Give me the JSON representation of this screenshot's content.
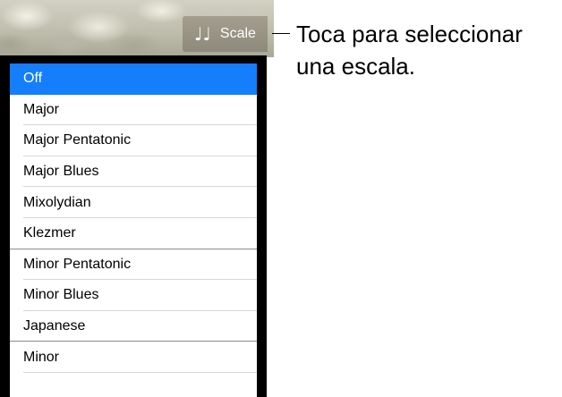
{
  "toolbar": {
    "scale_button": {
      "icon": "music-notes-icon",
      "glyph": "♩♩",
      "label": "Scale"
    }
  },
  "callout": {
    "text": "Toca para seleccionar una escala."
  },
  "scale_menu": {
    "selected": "Off",
    "items": [
      {
        "label": "Off"
      },
      {
        "label": "Major"
      },
      {
        "label": "Major Pentatonic"
      },
      {
        "label": "Major Blues"
      },
      {
        "label": "Mixolydian"
      },
      {
        "label": "Klezmer"
      },
      {
        "label": "Minor Pentatonic"
      },
      {
        "label": "Minor Blues"
      },
      {
        "label": "Japanese"
      },
      {
        "label": "Minor"
      }
    ]
  },
  "colors": {
    "selection": "#147efb",
    "panel": "#000000"
  }
}
